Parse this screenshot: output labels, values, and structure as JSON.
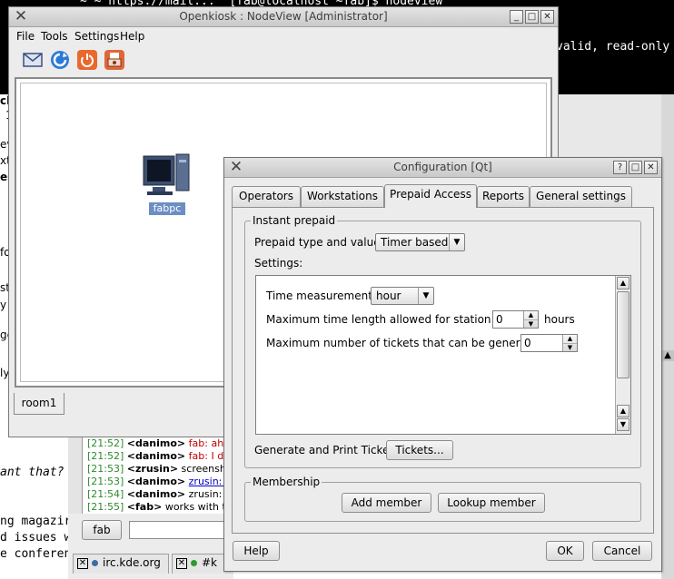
{
  "terminal": {
    "lines": [
      "~ ~ https://mail...  [fab@localhost ~fab]$ nodeview",
      "valid, read-only"
    ]
  },
  "background": {
    "left_fragments": [
      "o",
      "ch",
      "1",
      "ev",
      "xt",
      "es",
      "fo",
      "st",
      "y",
      "ge",
      "ly"
    ],
    "irc": {
      "lines": [
        {
          "time": "[21:52]",
          "nick": "<danimo>",
          "text": "fab: ah, o",
          "style": "red"
        },
        {
          "time": "[21:52]",
          "nick": "<danimo>",
          "text": "fab: I didn",
          "style": "red"
        },
        {
          "time": "[21:53]",
          "nick": "<zrusin>",
          "text": "screensho",
          "style": "normal"
        },
        {
          "time": "[21:53]",
          "nick": "<danimo>",
          "text": "zrusin: htt",
          "style": "link"
        },
        {
          "time": "[21:54]",
          "nick": "<danimo>",
          "text": "zrusin: it c",
          "style": "normal"
        },
        {
          "time": "[21:55]",
          "nick": "<fab>",
          "text": "works with tick",
          "style": "normal"
        }
      ],
      "nick_button": "fab",
      "tabs": [
        "irc.kde.org",
        "#k"
      ]
    },
    "terminal2_fragments": [
      "ant that?",
      "ng magazir",
      "d issues w",
      "e conferen"
    ]
  },
  "nodeview": {
    "title": "Openkiosk : NodeView [Administrator]",
    "menus": [
      "File",
      "Tools",
      "Settings",
      "Help"
    ],
    "toolbar": [
      "mail-icon",
      "refresh-icon",
      "power-icon",
      "print-icon"
    ],
    "station_label": "fabpc",
    "room_tab": "room1"
  },
  "config": {
    "title": "Configuration [Qt]",
    "tabs": [
      "Operators",
      "Workstations",
      "Prepaid Access",
      "Reports",
      "General settings"
    ],
    "active_tab": "Prepaid Access",
    "instant_prepaid": {
      "title": "Instant prepaid",
      "type_label": "Prepaid type and value:",
      "type_value": "Timer based",
      "settings_label": "Settings:",
      "time_measurement_label": "Time measurement:",
      "time_measurement_value": "hour",
      "max_time_label": "Maximum time length allowed for station use:",
      "max_time_value": "0",
      "max_time_unit": "hours",
      "max_tickets_label": "Maximum number of tickets that can be generated:",
      "max_tickets_value": "0",
      "generate_label": "Generate and Print Tickets",
      "tickets_button": "Tickets..."
    },
    "membership": {
      "title": "Membership",
      "add_button": "Add member",
      "lookup_button": "Lookup member"
    },
    "help_button": "Help",
    "ok_button": "OK",
    "cancel_button": "Cancel"
  }
}
